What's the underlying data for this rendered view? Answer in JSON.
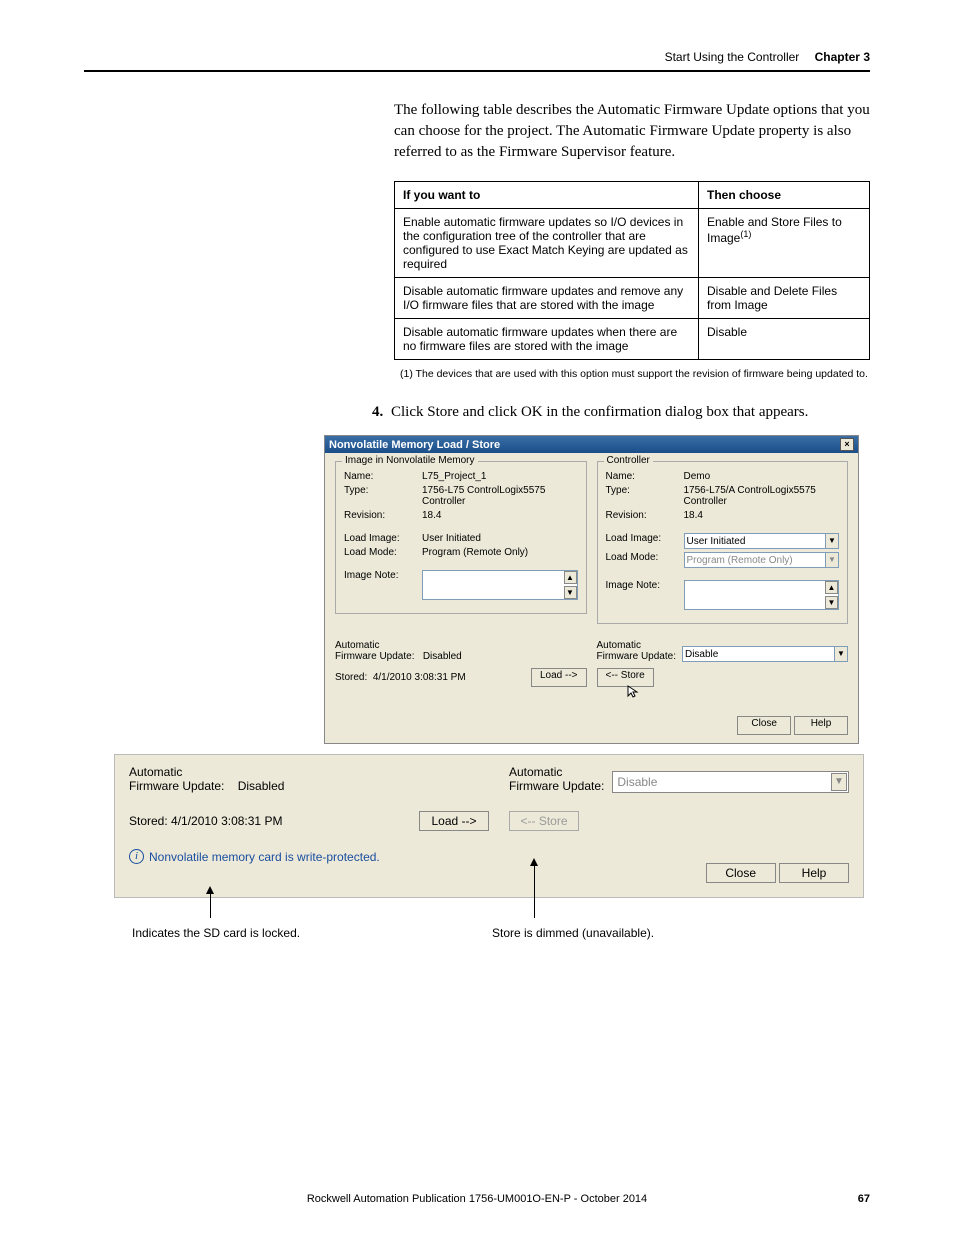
{
  "header": {
    "title": "Start Using the Controller",
    "chapter": "Chapter 3"
  },
  "intro": "The following table describes the Automatic Firmware Update options that you can choose for the project. The Automatic Firmware Update property is also referred to as the Firmware Supervisor feature.",
  "table": {
    "headers": [
      "If you want to",
      "Then choose"
    ],
    "rows": [
      {
        "want": "Enable automatic firmware updates so I/O devices in the configuration tree of the controller that are configured to use Exact Match Keying are updated as required",
        "choose": "Enable and Store Files to Image",
        "sup": "(1)"
      },
      {
        "want": "Disable automatic firmware updates and remove any I/O firmware files that are stored with the image",
        "choose": "Disable and Delete Files from Image",
        "sup": ""
      },
      {
        "want": "Disable automatic firmware updates when there are no firmware files are stored with the image",
        "choose": "Disable",
        "sup": ""
      }
    ]
  },
  "footnote": "(1)   The devices that are used with this option must support the revision of firmware being updated to.",
  "step": {
    "num": "4.",
    "text": "Click Store and click OK in the confirmation dialog box that appears."
  },
  "dialog": {
    "title": "Nonvolatile Memory Load / Store",
    "close_x": "×",
    "image_panel": {
      "legend": "Image in Nonvolatile Memory",
      "name_lbl": "Name:",
      "name_val": "L75_Project_1",
      "type_lbl": "Type:",
      "type_val": "1756-L75 ControlLogix5575 Controller",
      "rev_lbl": "Revision:",
      "rev_val": "18.4",
      "loadimg_lbl": "Load Image:",
      "loadimg_val": "User Initiated",
      "loadmode_lbl": "Load Mode:",
      "loadmode_val": "Program (Remote Only)",
      "imgnote_lbl": "Image Note:"
    },
    "ctrl_panel": {
      "legend": "Controller",
      "name_lbl": "Name:",
      "name_val": "Demo",
      "type_lbl": "Type:",
      "type_val": "1756-L75/A ControlLogix5575 Controller",
      "rev_lbl": "Revision:",
      "rev_val": "18.4",
      "loadimg_lbl": "Load Image:",
      "loadimg_val": "User Initiated",
      "loadmode_lbl": "Load Mode:",
      "loadmode_val": "Program (Remote Only)",
      "imgnote_lbl": "Image Note:"
    },
    "afu_lbl": "Automatic",
    "afu_lbl2": "Firmware Update:",
    "afu_left_val": "Disabled",
    "afu_right_val": "Disable",
    "stored_lbl": "Stored:",
    "stored_val": "4/1/2010  3:08:31 PM",
    "load_btn": "Load -->",
    "store_btn": "<-- Store",
    "close_btn": "Close",
    "help_btn": "Help"
  },
  "zoom": {
    "afu_lbl": "Automatic",
    "afu_lbl2": "Firmware Update:",
    "afu_left_val": "Disabled",
    "afu_right_val": "Disable",
    "stored": "Stored:  4/1/2010  3:08:31 PM",
    "load_btn": "Load -->",
    "store_btn": "<-- Store",
    "info_text": "Nonvolatile memory card is write-protected.",
    "close_btn": "Close",
    "help_btn": "Help"
  },
  "callout1": "Indicates the SD card is locked.",
  "callout2": "Store is dimmed (unavailable).",
  "footer": {
    "pub": "Rockwell Automation Publication 1756-UM001O-EN-P - October 2014",
    "page": "67"
  }
}
